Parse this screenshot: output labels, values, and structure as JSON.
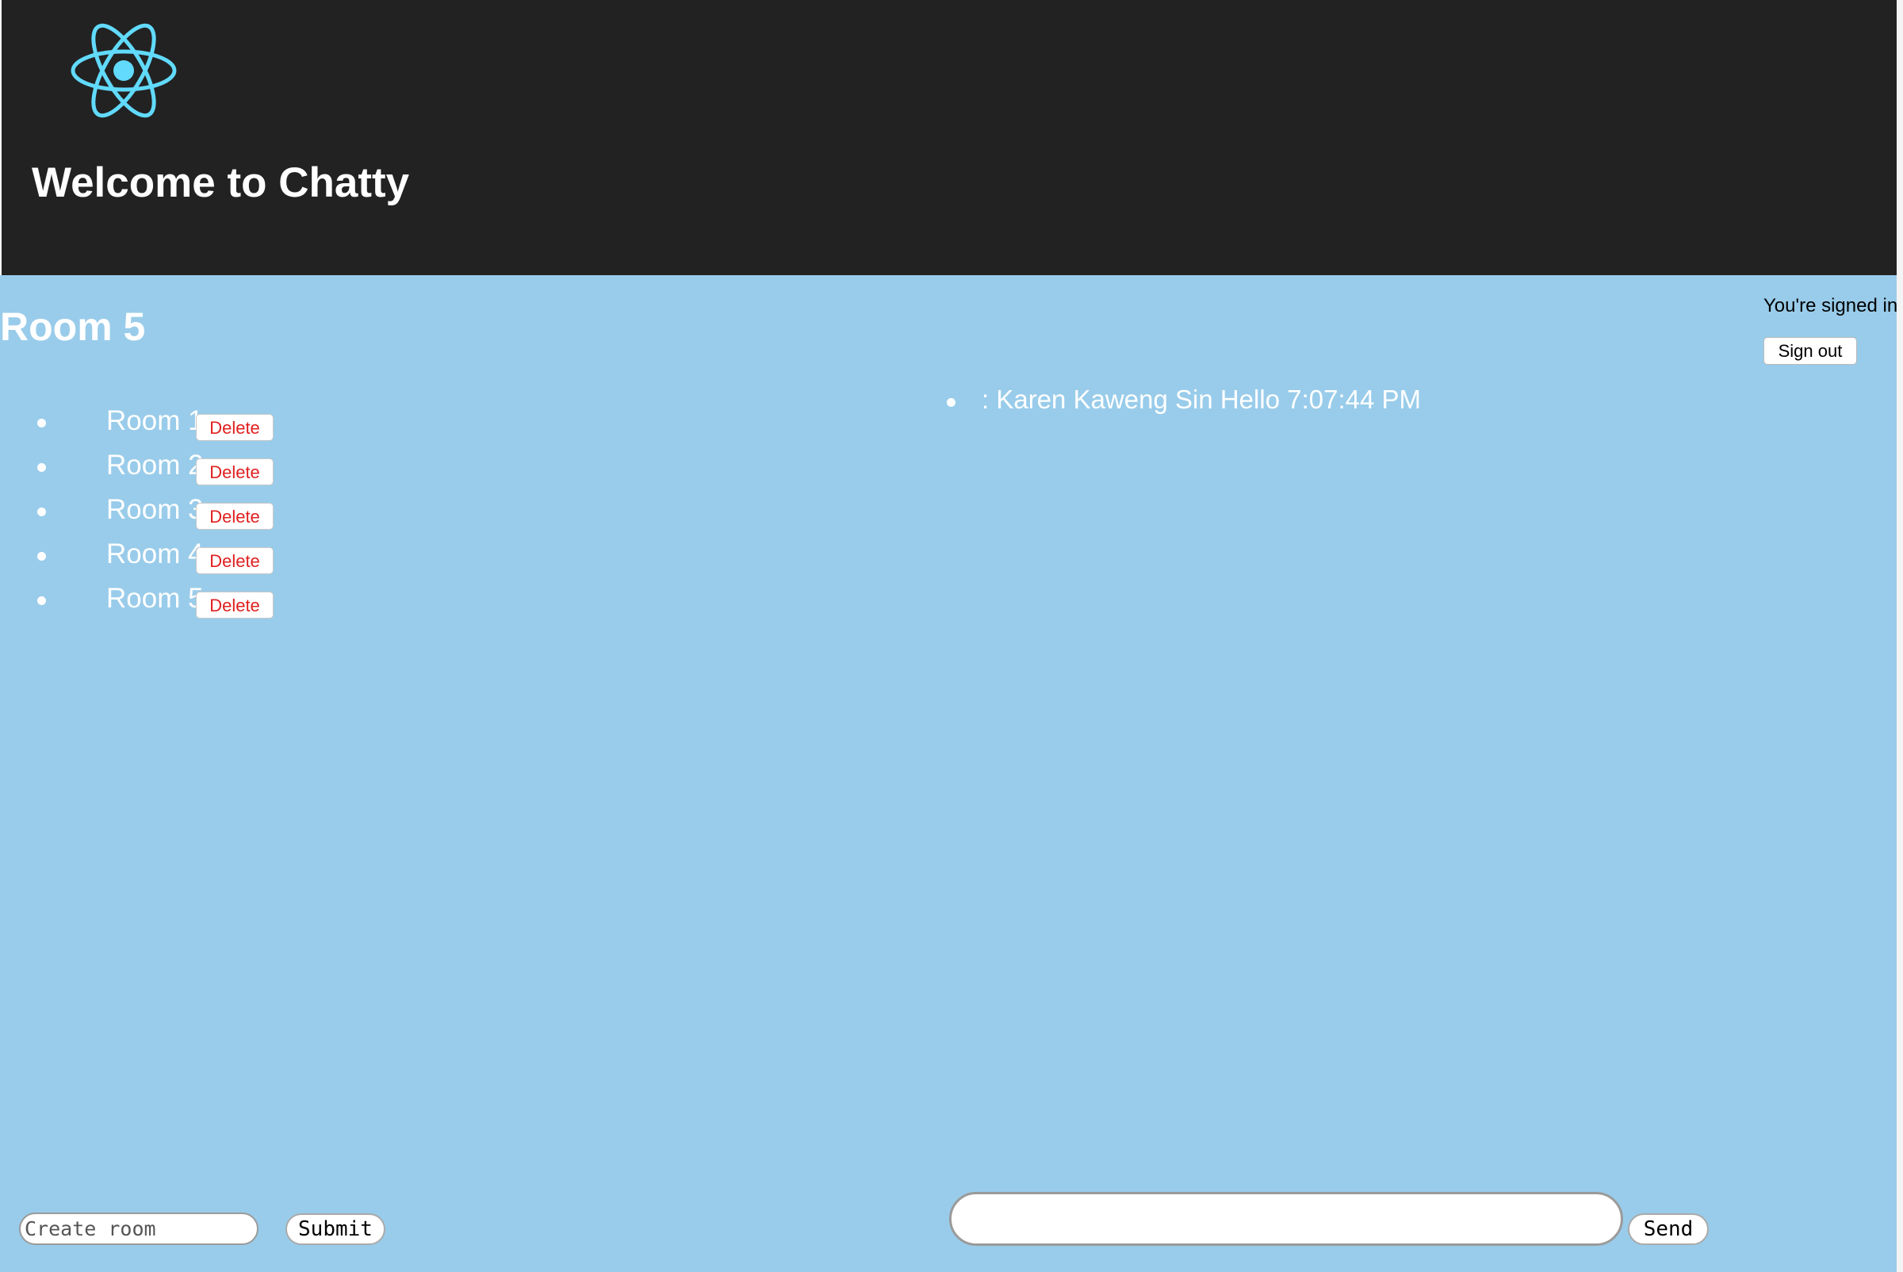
{
  "colors": {
    "header_bg": "#222222",
    "page_bg": "#99ccea",
    "logo": "#61dafb",
    "delete_text": "#e02020"
  },
  "header": {
    "logo_icon": "react-atom-icon",
    "title": "Welcome to Chatty"
  },
  "current_room": {
    "title": "Room 5"
  },
  "rooms": [
    {
      "name": "Room 1",
      "delete_label": "Delete"
    },
    {
      "name": "Room 2",
      "delete_label": "Delete"
    },
    {
      "name": "Room 3",
      "delete_label": "Delete"
    },
    {
      "name": "Room 4",
      "delete_label": "Delete"
    },
    {
      "name": "Room 5",
      "delete_label": "Delete"
    }
  ],
  "messages": [
    {
      "text": ": Karen Kaweng Sin Hello 7:07:44 PM"
    }
  ],
  "auth": {
    "status_text": "You're signed in",
    "signout_label": "Sign out"
  },
  "create_room": {
    "placeholder": "Create room",
    "value": "",
    "submit_label": "Submit"
  },
  "composer": {
    "value": "",
    "send_label": "Send"
  }
}
